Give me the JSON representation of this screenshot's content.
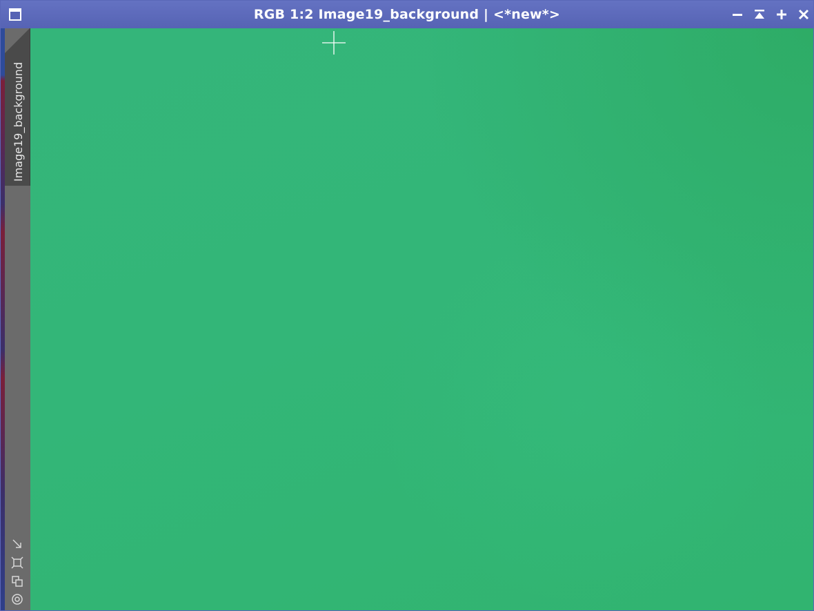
{
  "window": {
    "title": "RGB 1:2 Image19_background | <*new*>",
    "controls": [
      "minimize",
      "shade",
      "maximize",
      "close"
    ]
  },
  "side_panel": {
    "tab_label": "Image19_background",
    "tools": [
      "resize-arrow-icon",
      "fit-frame-icon",
      "clone-icon",
      "target-icon"
    ]
  },
  "canvas": {
    "fill_color": "#33b678"
  },
  "colors": {
    "titlebar": "#5663b4",
    "side_panel": "#6b6b6b",
    "side_tab": "#4a4a4a"
  }
}
